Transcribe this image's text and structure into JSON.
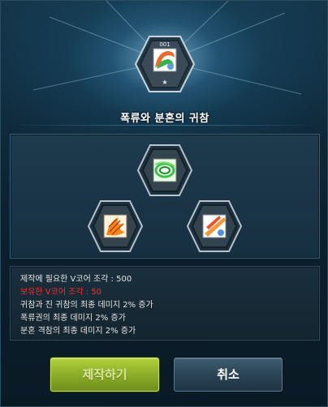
{
  "window": {
    "title": "폭류와 분혼의 귀참"
  },
  "result_core": {
    "level": "001",
    "star": "★",
    "icon": "core-skill-icon"
  },
  "ingredients": [
    {
      "name": "center-core",
      "icon": "green-swirl-skill-icon"
    },
    {
      "name": "left-core",
      "icon": "orange-claw-skill-icon"
    },
    {
      "name": "right-core",
      "icon": "orange-slash-skill-icon"
    }
  ],
  "info": {
    "lines": [
      "제작에 필요한 V코어 조각 : 500",
      "보유한 V코어 조각 : 50",
      "귀참과 진 귀참의 최종 데미지 2% 증가",
      "폭류권의 최종 데미지 2% 증가",
      "분혼 격참의 최종 데미지 2% 증가"
    ],
    "warning_color": "#ff2a2a"
  },
  "buttons": {
    "craft": "제작하기",
    "cancel": "취소"
  },
  "colors": {
    "craft_button": "#8fb12a",
    "cancel_button": "#2a4456"
  }
}
